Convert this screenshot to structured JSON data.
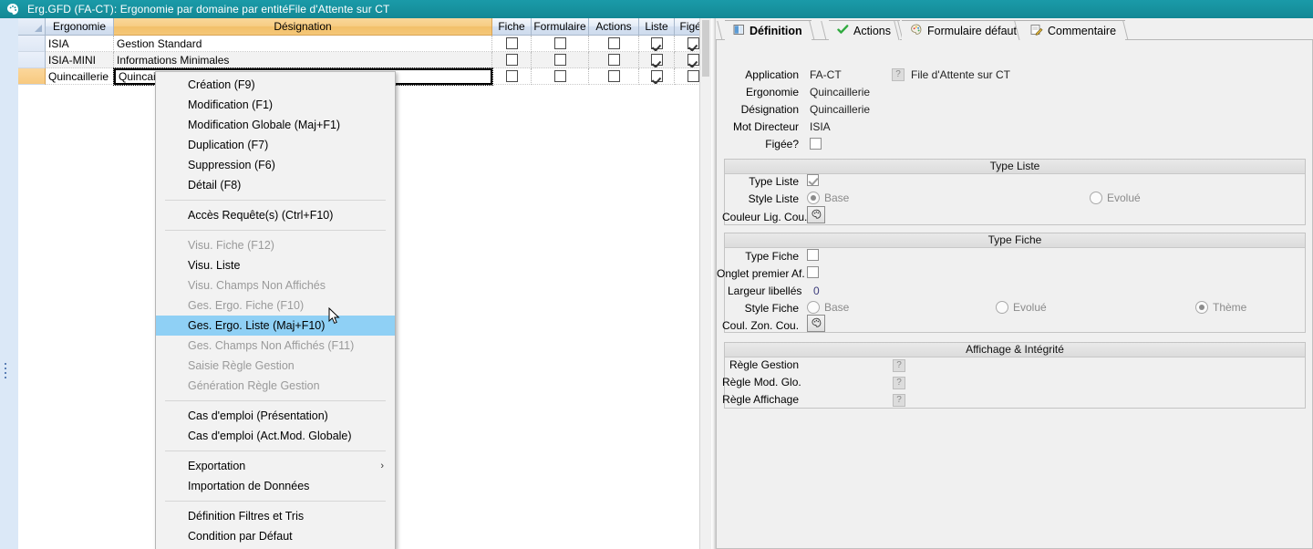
{
  "window": {
    "icon": "palette-icon",
    "title": "Erg.GFD (FA-CT): Ergonomie par domaine par entitéFile d'Attente sur CT"
  },
  "grid": {
    "columns": [
      {
        "key": "idx",
        "label": ""
      },
      {
        "key": "ergonomie",
        "label": "Ergonomie"
      },
      {
        "key": "designation",
        "label": "Désignation"
      },
      {
        "key": "fiche",
        "label": "Fiche"
      },
      {
        "key": "formulaire",
        "label": "Formulaire"
      },
      {
        "key": "actions",
        "label": "Actions"
      },
      {
        "key": "liste",
        "label": "Liste"
      },
      {
        "key": "figee",
        "label": "Figée"
      }
    ],
    "rows": [
      {
        "ergonomie": "ISIA",
        "designation": "Gestion Standard",
        "fiche": false,
        "formulaire": false,
        "actions": false,
        "liste": true,
        "figee": true,
        "selected": false,
        "editing": false
      },
      {
        "ergonomie": "ISIA-MINI",
        "designation": "Informations Minimales",
        "fiche": false,
        "formulaire": false,
        "actions": false,
        "liste": true,
        "figee": true,
        "selected": false,
        "editing": false
      },
      {
        "ergonomie": "Quincaillerie",
        "designation": "Quincaillerie",
        "fiche": false,
        "formulaire": false,
        "actions": false,
        "liste": true,
        "figee": false,
        "selected": true,
        "editing": true
      }
    ]
  },
  "context_menu": {
    "items": [
      {
        "label": "Création (F9)",
        "state": "enabled"
      },
      {
        "label": "Modification (F1)",
        "state": "enabled"
      },
      {
        "label": "Modification Globale (Maj+F1)",
        "state": "enabled"
      },
      {
        "label": "Duplication (F7)",
        "state": "enabled"
      },
      {
        "label": "Suppression (F6)",
        "state": "enabled"
      },
      {
        "label": "Détail (F8)",
        "state": "enabled"
      },
      {
        "separator": true
      },
      {
        "label": "Accès Requête(s) (Ctrl+F10)",
        "state": "enabled"
      },
      {
        "separator": true
      },
      {
        "label": "Visu. Fiche (F12)",
        "state": "disabled"
      },
      {
        "label": "Visu. Liste",
        "state": "enabled"
      },
      {
        "label": "Visu. Champs Non Affichés",
        "state": "disabled"
      },
      {
        "label": "Ges. Ergo. Fiche (F10)",
        "state": "disabled"
      },
      {
        "label": "Ges. Ergo. Liste (Maj+F10)",
        "state": "highlighted"
      },
      {
        "label": "Ges. Champs Non Affichés (F11)",
        "state": "disabled"
      },
      {
        "label": "Saisie Règle Gestion",
        "state": "disabled"
      },
      {
        "label": "Génération Règle Gestion",
        "state": "disabled"
      },
      {
        "separator": true
      },
      {
        "label": "Cas d'emploi (Présentation)",
        "state": "enabled"
      },
      {
        "label": "Cas d'emploi (Act.Mod. Globale)",
        "state": "enabled"
      },
      {
        "separator": true
      },
      {
        "label": "Exportation",
        "state": "enabled",
        "submenu": "›"
      },
      {
        "label": "Importation de Données",
        "state": "enabled"
      },
      {
        "separator": true
      },
      {
        "label": "Définition Filtres et Tris",
        "state": "enabled"
      },
      {
        "label": "Condition par Défaut",
        "state": "enabled"
      }
    ]
  },
  "right_panel": {
    "tabs": [
      {
        "label": "Définition",
        "icon": "book-icon",
        "active": true
      },
      {
        "label": "Actions",
        "icon": "check-icon",
        "active": false
      },
      {
        "label": "Formulaire défaut",
        "icon": "palette-icon",
        "active": false
      },
      {
        "label": "Commentaire",
        "icon": "note-pencil-icon",
        "active": false
      }
    ],
    "header_fields": [
      {
        "label": "Application",
        "value": "FA-CT"
      },
      {
        "label": "Ergonomie",
        "value": "Quincaillerie"
      },
      {
        "label": "Désignation",
        "value": "Quincaillerie"
      },
      {
        "label": "Mot Directeur",
        "value": "ISIA"
      },
      {
        "label": "Figée?",
        "value": ""
      }
    ],
    "application_note": "File d'Attente sur CT",
    "figee_checked": false,
    "group_type_liste": {
      "title": "Type Liste",
      "type_liste_label": "Type Liste",
      "type_liste_checked": true,
      "style_liste_label": "Style Liste",
      "style_options": [
        {
          "label": "Base",
          "selected": true
        },
        {
          "label": "Evolué",
          "selected": false
        }
      ],
      "couleur_label": "Couleur Lig. Cou."
    },
    "group_type_fiche": {
      "title": "Type Fiche",
      "type_fiche_label": "Type Fiche",
      "type_fiche_checked": false,
      "onglet_label": "Onglet premier Af.",
      "onglet_checked": false,
      "largeur_label": "Largeur libellés",
      "largeur_value": "0",
      "style_fiche_label": "Style Fiche",
      "style_options": [
        {
          "label": "Base",
          "selected": false
        },
        {
          "label": "Evolué",
          "selected": false
        },
        {
          "label": "Thème",
          "selected": true
        }
      ],
      "couleur_label": "Coul. Zon. Cou."
    },
    "group_affichage": {
      "title": "Affichage & Intégrité",
      "rules": [
        {
          "label": "Règle Gestion",
          "badge": "?"
        },
        {
          "label": "Règle Mod. Glo.",
          "badge": "?"
        },
        {
          "label": "Règle Affichage",
          "badge": "?"
        }
      ]
    }
  },
  "colors": {
    "titlebar": "#17929f",
    "header_orange": "#f5c778",
    "header_blue": "#d4e0f0",
    "menu_highlight": "#8fd0f5",
    "panel_bg": "#f0f0f0"
  }
}
